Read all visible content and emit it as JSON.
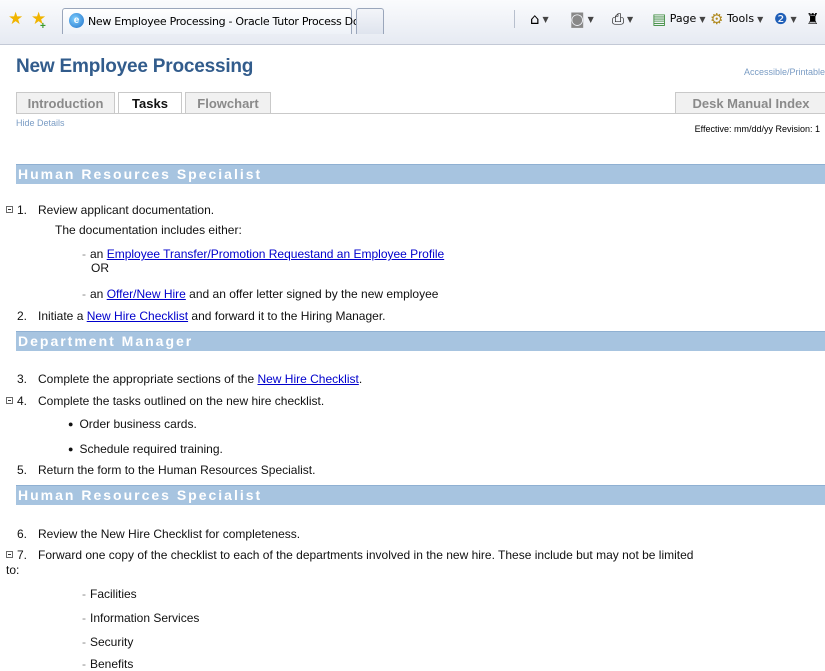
{
  "browser": {
    "tab_title": "New Employee Processing - Oracle Tutor Process Doc...",
    "commands": {
      "page": "Page",
      "tools": "Tools"
    }
  },
  "page": {
    "title": "New Employee Processing",
    "accessible_link": "Accessible/Printable",
    "tabs": [
      "Introduction",
      "Tasks",
      "Flowchart"
    ],
    "desk_manual": "Desk Manual Index",
    "hide_details": "Hide Details",
    "effective": "Effective: mm/dd/yy  Revision: 1"
  },
  "sections": [
    {
      "role": "Human Resources Specialist"
    },
    {
      "role": "Department Manager"
    },
    {
      "role": "Human Resources Specialist"
    }
  ],
  "steps": {
    "s1": {
      "num": "1.",
      "text": "Review applicant documentation."
    },
    "s1_intro": "The documentation includes either:",
    "s1_opt1": {
      "pre": "an ",
      "link": "Employee Transfer/Promotion Requestand an Employee Profile",
      "or": "OR"
    },
    "s1_opt2": {
      "pre": "an ",
      "link": "Offer/New Hire",
      "post": " and an offer letter signed by the new employee"
    },
    "s2": {
      "num": "2.",
      "pre": "Initiate a ",
      "link": "New Hire Checklist",
      "post": " and forward it to the Hiring Manager."
    },
    "s3": {
      "num": "3.",
      "pre": "Complete the appropriate sections of the ",
      "link": "New Hire Checklist",
      "post": "."
    },
    "s4": {
      "num": "4.",
      "text": "Complete the tasks outlined on the new hire checklist."
    },
    "s4_b1": "Order business cards.",
    "s4_b2": "Schedule required training.",
    "s5": {
      "num": "5.",
      "text": "Return the form to the Human Resources Specialist."
    },
    "s6": {
      "num": "6.",
      "text": "Review the New Hire Checklist for completeness."
    },
    "s7": {
      "num": "7.",
      "text": "Forward one copy of the checklist to each of the departments involved in the new hire.  These include but may not be limited",
      "cont": "to:"
    },
    "s7_items": [
      "Facilities",
      "Information Services",
      "Security",
      "Benefits"
    ]
  }
}
